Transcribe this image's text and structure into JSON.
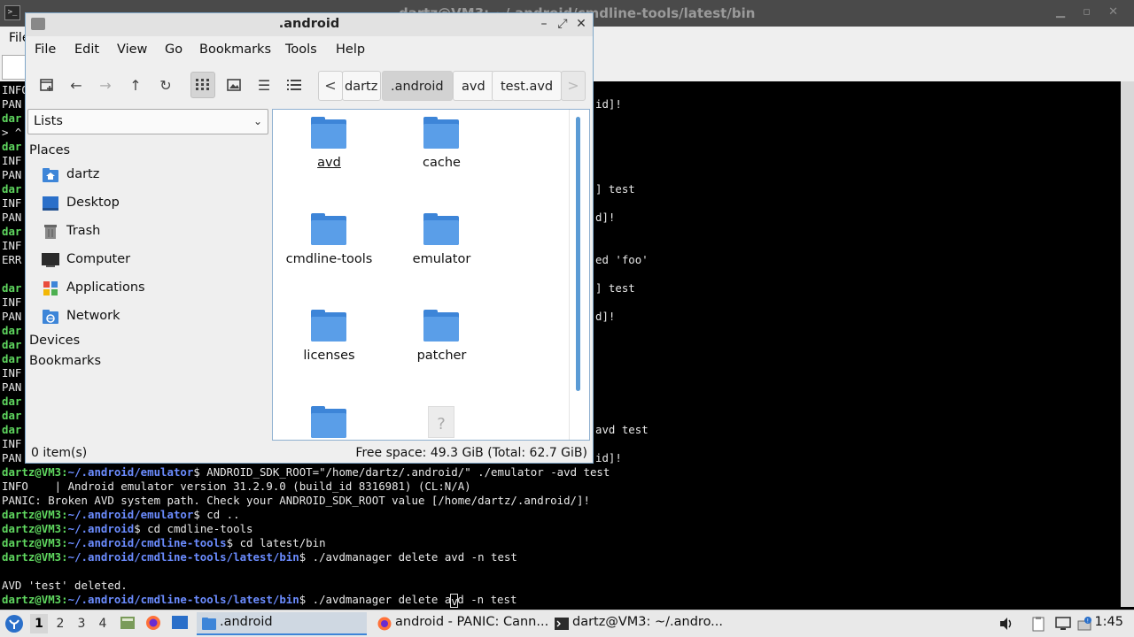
{
  "terminal": {
    "title": "dartz@VM3: ~/.android/cmdline-tools/latest/bin",
    "menu_file": "File",
    "left_fragments": [
      "INFO",
      "PAN",
      "dar",
      "> ^",
      "dar",
      "INF",
      "PAN",
      "dar",
      "INF",
      "PAN",
      "dar",
      "INF",
      "ERR",
      "",
      "dar",
      "INF",
      "PAN",
      "dar",
      "dar",
      "dar",
      "INF",
      "PAN",
      "dar",
      "dar",
      "dar",
      "INF",
      "PAN"
    ],
    "right_fragments": [
      {
        "row": 1,
        "text": "id]!"
      },
      {
        "row": 7,
        "text": "] test"
      },
      {
        "row": 9,
        "text": "d]!"
      },
      {
        "row": 12,
        "text": "ed 'foo'"
      },
      {
        "row": 14,
        "text": "] test"
      },
      {
        "row": 16,
        "text": "d]!"
      },
      {
        "row": 24,
        "text": "avd test"
      },
      {
        "row": 26,
        "text": "id]!"
      }
    ],
    "lines": [
      {
        "user": "dartz@VM3",
        "path": "~/.android/emulator",
        "cmd": "$ ANDROID_SDK_ROOT=\"/home/dartz/.android/\" ./emulator -avd test"
      },
      {
        "text": "INFO    | Android emulator version 31.2.9.0 (build_id 8316981) (CL:N/A)"
      },
      {
        "text": "PANIC: Broken AVD system path. Check your ANDROID_SDK_ROOT value [/home/dartz/.android/]!"
      },
      {
        "user": "dartz@VM3",
        "path": "~/.android/emulator",
        "cmd": "$ cd .."
      },
      {
        "user": "dartz@VM3",
        "path": "~/.android",
        "cmd": "$ cd cmdline-tools"
      },
      {
        "user": "dartz@VM3",
        "path": "~/.android/cmdline-tools",
        "cmd": "$ cd latest/bin"
      },
      {
        "user": "dartz@VM3",
        "path": "~/.android/cmdline-tools/latest/bin",
        "cmd": "$ ./avdmanager delete avd -n test"
      },
      {
        "text": ""
      },
      {
        "text": "AVD 'test' deleted."
      }
    ],
    "last_line": {
      "user": "dartz@VM3",
      "path": "~/.android/cmdline-tools/latest/bin",
      "cmd_before": "$ ./avdmanager delete a",
      "cursor_char": "v",
      "cmd_after": "d -n test"
    }
  },
  "file_manager": {
    "title": ".android",
    "menus": [
      "File",
      "Edit",
      "View",
      "Go",
      "Bookmarks",
      "Tools",
      "Help"
    ],
    "breadcrumbs": [
      "dartz",
      ".android",
      "avd",
      "test.avd"
    ],
    "crumb_prev": "<",
    "crumb_next": ">",
    "side_pane_mode": "Lists",
    "places_heading": "Places",
    "places": [
      {
        "label": "dartz",
        "icon": "home-folder-icon"
      },
      {
        "label": "Desktop",
        "icon": "desktop-icon"
      },
      {
        "label": "Trash",
        "icon": "trash-icon"
      },
      {
        "label": "Computer",
        "icon": "computer-icon"
      },
      {
        "label": "Applications",
        "icon": "applications-icon"
      },
      {
        "label": "Network",
        "icon": "network-icon"
      }
    ],
    "devices_heading": "Devices",
    "bookmarks_heading": "Bookmarks",
    "items": [
      "avd",
      "cache",
      "cmdline-tools",
      "emulator",
      "licenses",
      "patcher",
      "",
      ""
    ],
    "unknown_glyph": "?",
    "status_selection": "0 item(s)",
    "status_space": "Free space: 49.3 GiB (Total: 62.7 GiB)",
    "colors": {
      "folder": "#5a9ee8",
      "folder_dark": "#3d85d8",
      "selection_border": "#7fa7c8"
    }
  },
  "taskbar": {
    "workspaces": [
      "1",
      "2",
      "3",
      "4"
    ],
    "active_workspace": "1",
    "tasks": [
      {
        "label": ".android",
        "icon": "folder-icon"
      },
      {
        "label": "android - PANIC: Cann...",
        "icon": "firefox-icon"
      },
      {
        "label": "dartz@VM3: ~/.andro...",
        "icon": "terminal-icon"
      }
    ],
    "clock": "1:45"
  }
}
